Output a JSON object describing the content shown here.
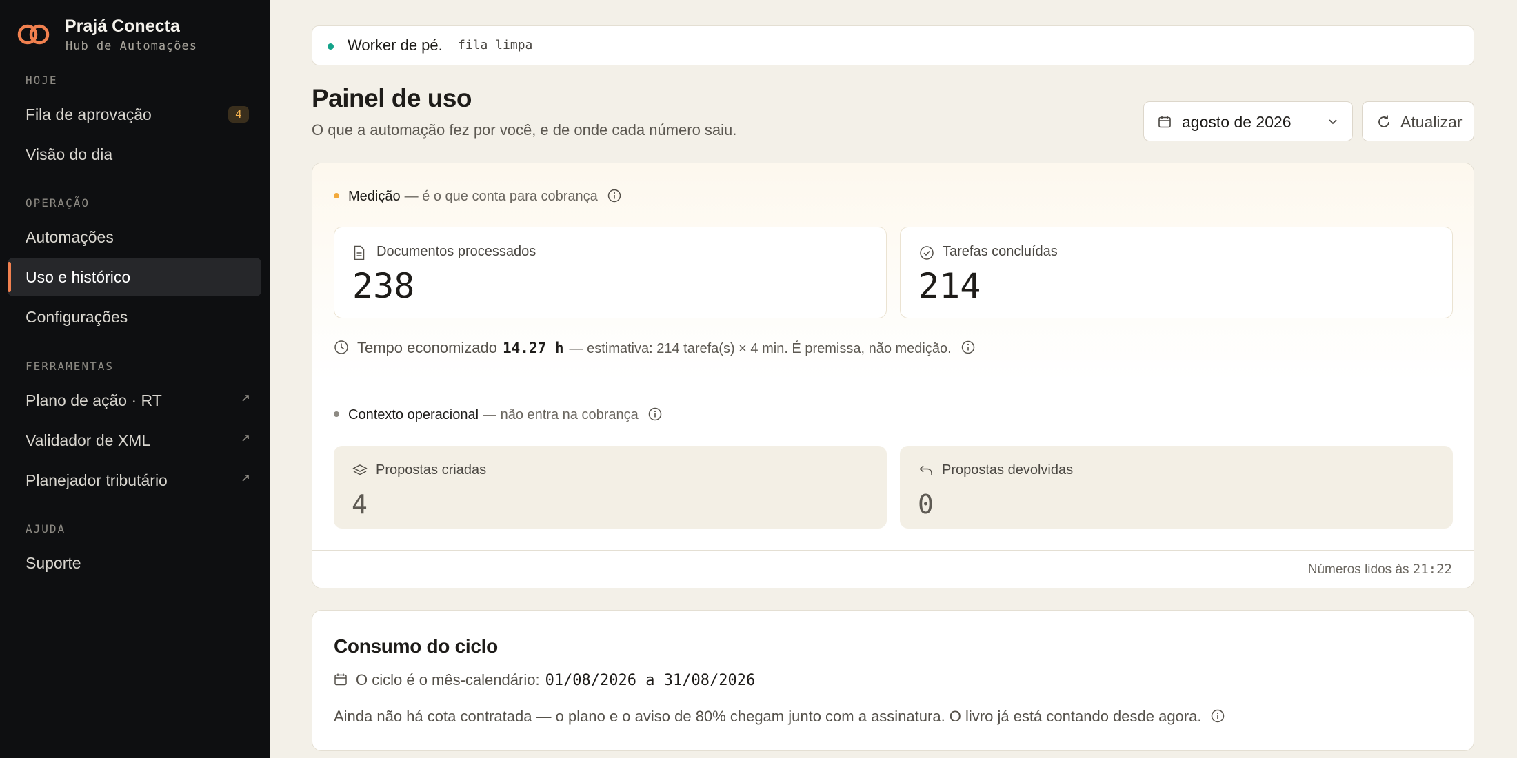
{
  "brand": {
    "name": "Prajá Conecta",
    "subtitle": "Hub de Automações"
  },
  "sidebar": {
    "sections": [
      {
        "label": "HOJE"
      },
      {
        "label": "OPERAÇÃO"
      },
      {
        "label": "FERRAMENTAS"
      },
      {
        "label": "AJUDA"
      }
    ],
    "items": [
      {
        "label": "Fila de aprovação",
        "badge": "4"
      },
      {
        "label": "Visão do dia"
      },
      {
        "label": "Automações"
      },
      {
        "label": "Uso e histórico",
        "active": true
      },
      {
        "label": "Configurações"
      },
      {
        "label": "Plano de ação · RT",
        "external": true
      },
      {
        "label": "Validador de XML",
        "external": true
      },
      {
        "label": "Planejador tributário",
        "external": true
      },
      {
        "label": "Suporte"
      }
    ]
  },
  "status": {
    "text": "Worker de pé.",
    "queue": "fila limpa",
    "color": "#14a38a"
  },
  "page": {
    "title": "Painel de uso",
    "subtitle": "O que a automação fez por você, e de onde cada número saiu."
  },
  "controls": {
    "month": "agosto de 2026",
    "refresh_label": "Atualizar"
  },
  "measurement": {
    "title": "Medição",
    "note": "— é o que conta para cobrança",
    "dot_color": "#f2a93b",
    "metrics": [
      {
        "label": "Documentos processados",
        "value": "238",
        "icon": "document-icon"
      },
      {
        "label": "Tarefas concluídas",
        "value": "214",
        "icon": "check-circle-icon"
      }
    ],
    "time_saved": {
      "label": "Tempo economizado",
      "value": "14.27 h",
      "note": "— estimativa: 214 tarefa(s) × 4 min. É premissa, não medição."
    }
  },
  "context": {
    "title": "Contexto operacional",
    "note": "— não entra na cobrança",
    "dot_color": "#8d8a83",
    "metrics": [
      {
        "label": "Propostas criadas",
        "value": "4",
        "icon": "layers-icon"
      },
      {
        "label": "Propostas devolvidas",
        "value": "0",
        "icon": "return-arrow-icon"
      }
    ]
  },
  "footer": {
    "read_label": "Números lidos às",
    "read_time": "21:22"
  },
  "cycle": {
    "title": "Consumo do ciclo",
    "range_label": "O ciclo é o mês-calendário:",
    "range_value": "01/08/2026 a 31/08/2026",
    "note": "Ainda não há cota contratada — o plano e o aviso de 80% chegam junto com a assinatura. O livro já está contando desde agora."
  },
  "colors": {
    "accent": "#f0804f",
    "sidebar_bg": "#0e0f11",
    "page_bg": "#f3f0e8"
  }
}
